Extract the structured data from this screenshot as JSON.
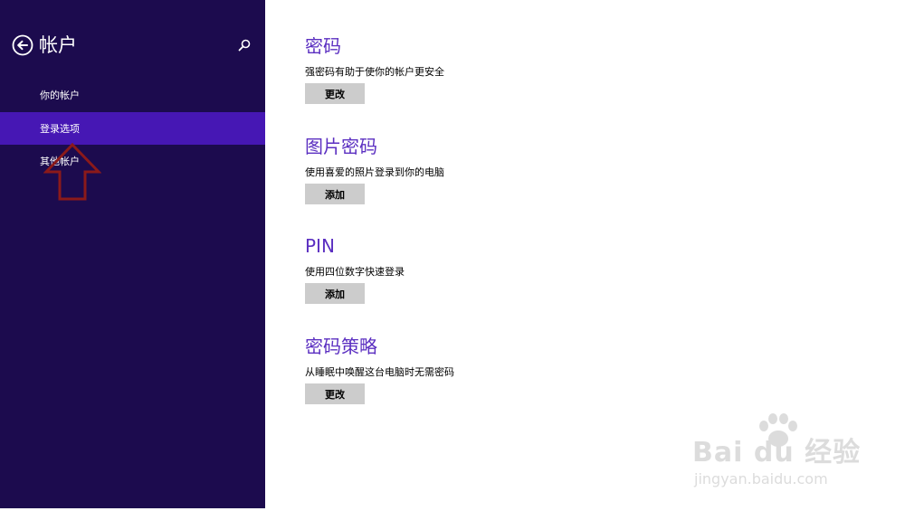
{
  "sidebar": {
    "title": "帐户",
    "items": [
      {
        "label": "你的帐户",
        "active": false
      },
      {
        "label": "登录选项",
        "active": true
      },
      {
        "label": "其他帐户",
        "active": false
      }
    ]
  },
  "sections": [
    {
      "heading": "密码",
      "description": "强密码有助于使你的帐户更安全",
      "button": "更改"
    },
    {
      "heading": "图片密码",
      "description": "使用喜爱的照片登录到你的电脑",
      "button": "添加"
    },
    {
      "heading": "PIN",
      "description": "使用四位数字快速登录",
      "button": "添加"
    },
    {
      "heading": "密码策略",
      "description": "从睡眠中唤醒这台电脑时无需密码",
      "button": "更改"
    }
  ],
  "watermark": {
    "brand": "Bai du 经验",
    "url": "jingyan.baidu.com"
  },
  "colors": {
    "sidebar_bg": "#1c0b4e",
    "active_item_bg": "#4617b4",
    "heading": "#5b2fc1",
    "button_bg": "#cccccc",
    "annotation_arrow": "#8b1a1a"
  }
}
